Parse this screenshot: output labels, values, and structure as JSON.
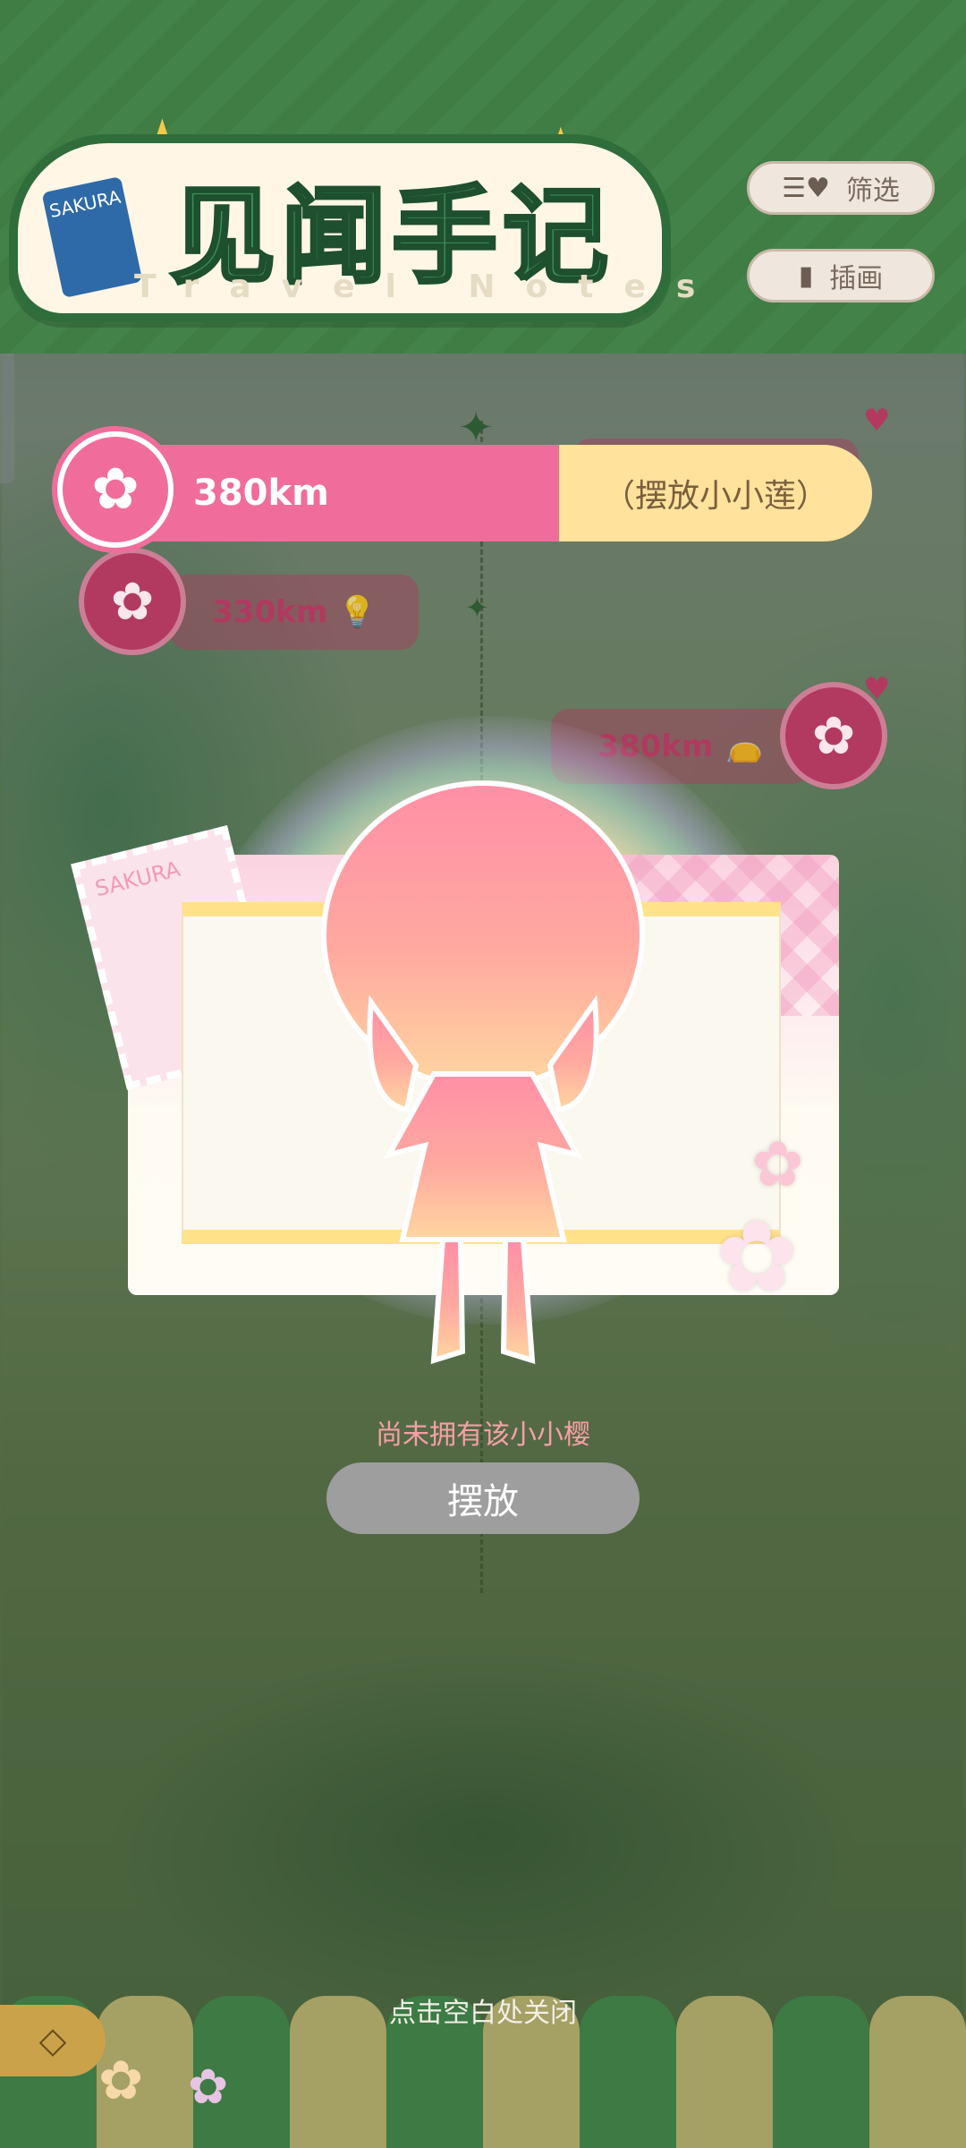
{
  "header": {
    "title": "见闻手记",
    "subtitle": "Travel Notes",
    "stamp_text": "SAKURA",
    "filter_label": "筛选",
    "illustration_label": "插画"
  },
  "timeline": {
    "active": {
      "distance": "380km",
      "tag_prefix": "（摆放",
      "tag_name": "小小莲",
      "tag_suffix": "）"
    },
    "items": [
      {
        "distance": "330km"
      },
      {
        "distance": "380km"
      }
    ]
  },
  "card": {
    "stamp_text": "SAKURA"
  },
  "status": {
    "not_owned": "尚未拥有该小小樱",
    "place_button": "摆放",
    "close_hint": "点击空白处关闭"
  },
  "colors": {
    "accent_pink": "#f06d9b",
    "tag_yellow": "#ffe29c",
    "disabled_gray": "#9e9e9e",
    "header_green": "#3f7d45"
  },
  "icons": [
    "flower-icon",
    "filter-icon",
    "book-icon",
    "back-arrow-icon",
    "heart-icon",
    "bag-icon",
    "bulb-icon",
    "sparkle-icon"
  ]
}
